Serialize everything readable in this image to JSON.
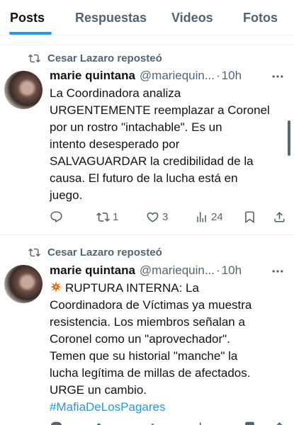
{
  "tabs": [
    {
      "label": "Posts",
      "active": true
    },
    {
      "label": "Respuestas",
      "active": false
    },
    {
      "label": "Videos",
      "active": false
    },
    {
      "label": "Fotos",
      "active": false
    }
  ],
  "colors": {
    "accent": "#1d9bf0",
    "text": "#0f1419",
    "muted": "#536471"
  },
  "posts": [
    {
      "repost_text": "Cesar Lazaro reposteó",
      "author_name": "marie quintana",
      "author_handle": "@mariequin...",
      "separator": "·",
      "time": "10h",
      "lines": [
        "La Coordinadora analiza",
        "URGENTEMENTE reemplazar a Coronel",
        "por un rostro \"intachable\". Es un",
        "intento desesperado por",
        "SALVAGUARDAR la credibilidad de la",
        "causa. El futuro de la lucha está en",
        "juego."
      ],
      "stats": {
        "replies": "",
        "reposts": "1",
        "likes": "3",
        "views": "24"
      }
    },
    {
      "repost_text": "Cesar Lazaro reposteó",
      "author_name": "marie quintana",
      "author_handle": "@mariequin...",
      "separator": "·",
      "time": "10h",
      "emoji": "collision-emoji",
      "lines": [
        "RUPTURA INTERNA: La",
        "Coordinadora de Víctimas ya muestra",
        "resistencia. Los miembros señalan a",
        "Coronel como un \"aprovechador\".",
        "Temen que su historial \"manche\" la",
        "lucha legítima de millas de afectados.",
        "URGE un cambio."
      ],
      "hashtag": "#MafiaDeLosPagares"
    }
  ]
}
